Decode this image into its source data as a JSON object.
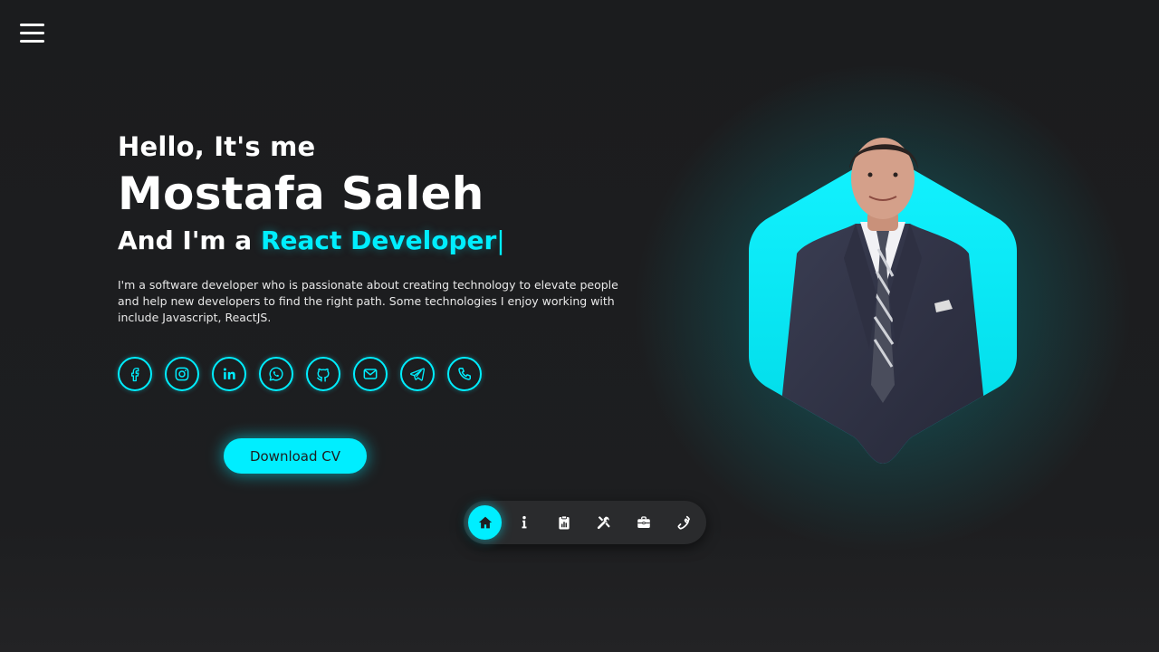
{
  "menu": {
    "icon": "hamburger-menu-icon"
  },
  "hero": {
    "greeting": "Hello, It's me",
    "name": "Mostafa Saleh",
    "role_prefix": "And I'm a ",
    "role_highlight": "React Developer",
    "role_cursor": "|",
    "bio": "I'm a software developer who is passionate about creating technology to elevate people and help new developers to find the right path. Some technologies I enjoy working with include Javascript, ReactJS."
  },
  "socials": [
    {
      "icon": "facebook-icon"
    },
    {
      "icon": "instagram-icon"
    },
    {
      "icon": "linkedin-icon"
    },
    {
      "icon": "whatsapp-icon"
    },
    {
      "icon": "github-icon"
    },
    {
      "icon": "email-icon"
    },
    {
      "icon": "telegram-icon"
    },
    {
      "icon": "phone-icon"
    }
  ],
  "cv_button": {
    "label": "Download CV"
  },
  "dock": [
    {
      "icon": "home-icon",
      "active": true
    },
    {
      "icon": "info-icon",
      "active": false
    },
    {
      "icon": "clipboard-icon",
      "active": false
    },
    {
      "icon": "tools-icon",
      "active": false
    },
    {
      "icon": "briefcase-icon",
      "active": false
    },
    {
      "icon": "phone-icon",
      "active": false
    }
  ],
  "colors": {
    "accent": "#00eeff",
    "background": "#1c1d1f",
    "dock": "#2a2b2d"
  }
}
